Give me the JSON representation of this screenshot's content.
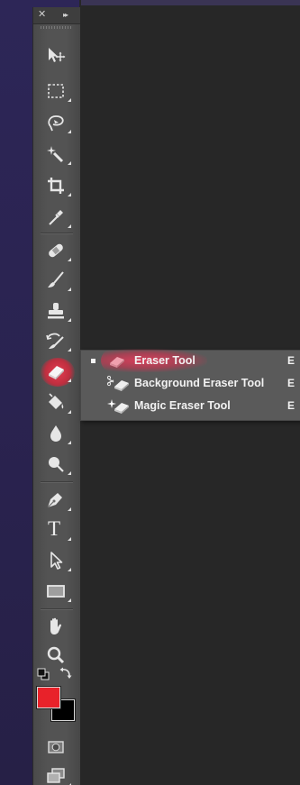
{
  "colors": {
    "foreground": "#e8222a",
    "background": "#000000",
    "highlight": "#e03a50"
  },
  "toolbar": {
    "header": {
      "close_glyph": "✕",
      "collapse_glyph": "▸▸"
    },
    "tools": [
      {
        "name": "move-tool",
        "icon": "move-arrow-icon"
      },
      {
        "name": "marquee-tool",
        "icon": "rect-marquee-icon"
      },
      {
        "name": "lasso-tool",
        "icon": "lasso-icon"
      },
      {
        "name": "magic-wand-tool",
        "icon": "magic-wand-icon"
      },
      {
        "name": "crop-tool",
        "icon": "crop-icon"
      },
      {
        "name": "eyedropper-tool",
        "icon": "eyedropper-icon"
      },
      {
        "name": "healing-brush-tool",
        "icon": "bandage-icon"
      },
      {
        "name": "brush-tool",
        "icon": "brush-icon"
      },
      {
        "name": "clone-stamp-tool",
        "icon": "stamp-icon"
      },
      {
        "name": "history-brush-tool",
        "icon": "history-brush-icon"
      },
      {
        "name": "eraser-tool",
        "icon": "eraser-icon",
        "active": true
      },
      {
        "name": "paint-bucket-tool",
        "icon": "paint-bucket-icon"
      },
      {
        "name": "blur-tool",
        "icon": "drop-icon"
      },
      {
        "name": "dodge-tool",
        "icon": "dodge-icon"
      },
      {
        "name": "pen-tool",
        "icon": "pen-nib-icon"
      },
      {
        "name": "type-tool",
        "icon": "type-icon",
        "glyph": "T"
      },
      {
        "name": "path-selection-tool",
        "icon": "path-select-arrow-icon"
      },
      {
        "name": "rectangle-tool",
        "icon": "rectangle-shape-icon"
      },
      {
        "name": "hand-tool",
        "icon": "hand-icon"
      },
      {
        "name": "zoom-tool",
        "icon": "magnifier-icon"
      }
    ]
  },
  "eraser_flyout": {
    "items": [
      {
        "label": "Eraser Tool",
        "shortcut": "E",
        "icon": "eraser-icon",
        "active": true
      },
      {
        "label": "Background Eraser Tool",
        "shortcut": "E",
        "icon": "background-eraser-icon"
      },
      {
        "label": "Magic Eraser Tool",
        "shortcut": "E",
        "icon": "magic-eraser-icon"
      }
    ]
  }
}
